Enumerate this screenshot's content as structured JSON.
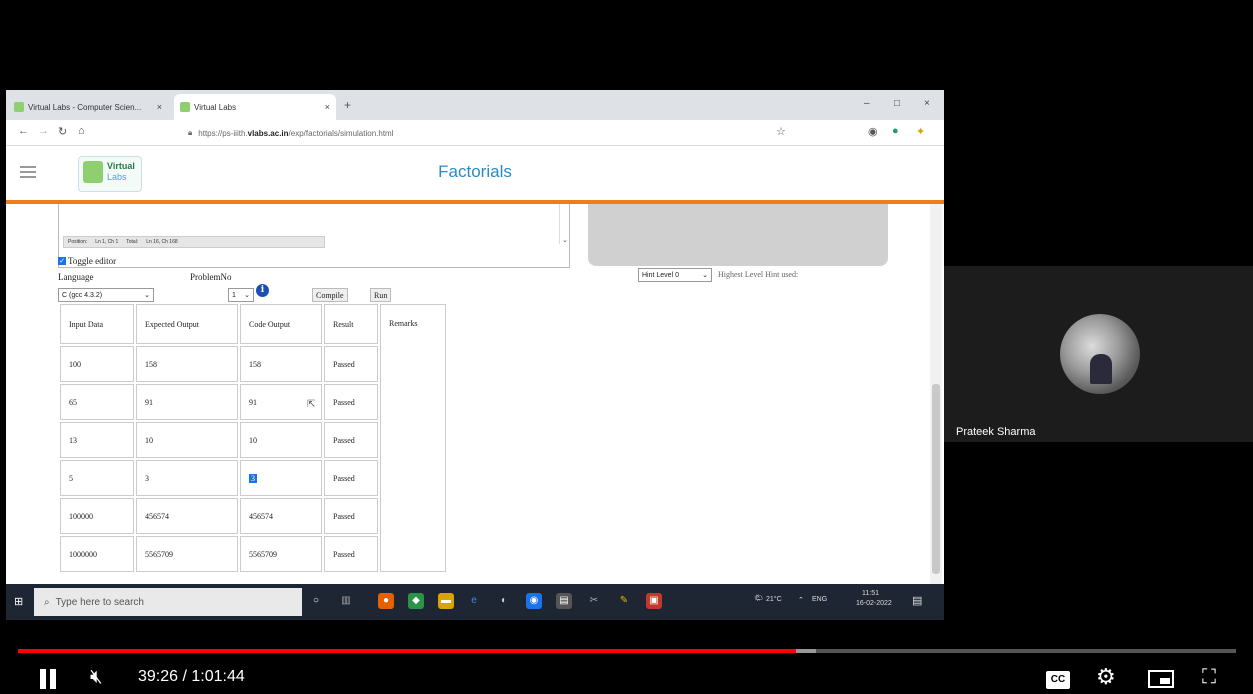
{
  "browser": {
    "tabs": [
      {
        "label": "Virtual Labs - Computer Scien...",
        "close": "×"
      },
      {
        "label": "Virtual Labs",
        "close": "×"
      }
    ],
    "new_tab": "+",
    "window_controls": {
      "minimize": "–",
      "maximize": "□",
      "close": "×"
    },
    "url": {
      "prefix": "https://ps-iiith.",
      "domain": "vlabs.ac.in",
      "suffix": "/exp/factorials/simulation.html"
    }
  },
  "site": {
    "logo": {
      "line1": "Virtual",
      "line2": "Labs"
    },
    "title": "Factorials"
  },
  "editor": {
    "status": {
      "position_label": "Position:",
      "position": "Ln 1, Ch 1",
      "total_label": "Total:",
      "total": "Ln 16, Ch 168"
    },
    "toggle_label": "Toggle editor",
    "language_label": "Language",
    "language_value": "C (gcc 4.3.2)",
    "problem_label": "ProblemNo",
    "problem_value": "1",
    "info": "i",
    "compile": "Compile",
    "run": "Run"
  },
  "hint": {
    "select_value": "Hint Level 0",
    "text": "Highest Level Hint used:"
  },
  "results": {
    "headers": [
      "Input Data",
      "Expected Output",
      "Code Output",
      "Result",
      "Remarks"
    ],
    "rows": [
      [
        "100",
        "158",
        "158",
        "Passed"
      ],
      [
        "65",
        "91",
        "91",
        "Passed"
      ],
      [
        "13",
        "10",
        "10",
        "Passed"
      ],
      [
        "5",
        "3",
        "3",
        "Passed"
      ],
      [
        "100000",
        "456574",
        "456574",
        "Passed"
      ],
      [
        "1000000",
        "5565709",
        "5565709",
        "Passed"
      ]
    ]
  },
  "taskbar": {
    "search_placeholder": "Type here to search",
    "weather": "21°C",
    "lang": "ENG",
    "time": "11:51",
    "date": "16-02-2022"
  },
  "presenter": {
    "name": "Prateek Sharma"
  },
  "player": {
    "time": "39:26 / 1:01:44",
    "progress": 0.639,
    "buffered": 0.655,
    "cc": "CC",
    "accent": "#ff0000"
  }
}
